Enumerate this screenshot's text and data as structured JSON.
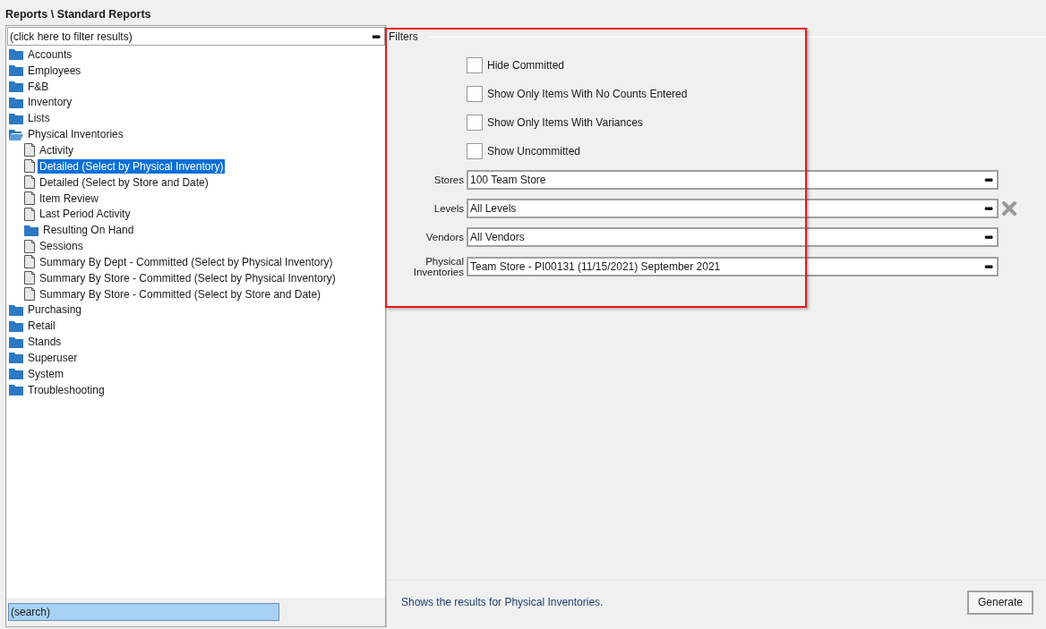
{
  "breadcrumb": "Reports \\ Standard Reports",
  "filter_field": {
    "placeholder": "(click here to filter results)",
    "button": "•••"
  },
  "tree": [
    {
      "label": "Accounts",
      "kind": "folder",
      "expanded": false,
      "selected": false
    },
    {
      "label": "Employees",
      "kind": "folder",
      "expanded": false,
      "selected": false
    },
    {
      "label": "F&B",
      "kind": "folder",
      "expanded": false,
      "selected": false
    },
    {
      "label": "Inventory",
      "kind": "folder",
      "expanded": false,
      "selected": false
    },
    {
      "label": "Lists",
      "kind": "folder",
      "expanded": false,
      "selected": false
    },
    {
      "label": "Physical Inventories",
      "kind": "folder",
      "expanded": true,
      "selected": false,
      "children": [
        {
          "label": "Activity",
          "kind": "report",
          "selected": false
        },
        {
          "label": "Detailed (Select by Physical Inventory)",
          "kind": "report",
          "selected": true
        },
        {
          "label": "Detailed (Select by Store and Date)",
          "kind": "report",
          "selected": false
        },
        {
          "label": "Item Review",
          "kind": "report",
          "selected": false
        },
        {
          "label": "Last Period Activity",
          "kind": "report",
          "selected": false
        },
        {
          "label": "Resulting On Hand",
          "kind": "folder",
          "expanded": false,
          "selected": false
        },
        {
          "label": "Sessions",
          "kind": "report",
          "selected": false
        },
        {
          "label": "Summary By Dept - Committed (Select by Physical Inventory)",
          "kind": "report",
          "selected": false
        },
        {
          "label": "Summary By Store - Committed (Select by Physical Inventory)",
          "kind": "report",
          "selected": false
        },
        {
          "label": "Summary By Store - Committed (Select by Store and Date)",
          "kind": "report",
          "selected": false
        }
      ]
    },
    {
      "label": "Purchasing",
      "kind": "folder",
      "expanded": false,
      "selected": false
    },
    {
      "label": "Retail",
      "kind": "folder",
      "expanded": false,
      "selected": false
    },
    {
      "label": "Stands",
      "kind": "folder",
      "expanded": false,
      "selected": false
    },
    {
      "label": "Superuser",
      "kind": "folder",
      "expanded": false,
      "selected": false
    },
    {
      "label": "System",
      "kind": "folder",
      "expanded": false,
      "selected": false
    },
    {
      "label": "Troubleshooting",
      "kind": "folder",
      "expanded": false,
      "selected": false
    }
  ],
  "search_field": {
    "placeholder": "(search)"
  },
  "filters": {
    "title": "Filters",
    "checkboxes": [
      {
        "label": "Hide Committed",
        "checked": false
      },
      {
        "label": "Show Only Items With No Counts Entered",
        "checked": false
      },
      {
        "label": "Show Only Items With Variances",
        "checked": false
      },
      {
        "label": "Show Uncommitted",
        "checked": false
      }
    ],
    "fields": [
      {
        "label": "Stores",
        "value": "100 Team Store",
        "button": "•••",
        "clearable": false
      },
      {
        "label": "Levels",
        "value": "All Levels",
        "button": "•••",
        "clearable": true
      },
      {
        "label": "Vendors",
        "value": "All Vendors",
        "button": "•••",
        "clearable": false
      },
      {
        "label": "Physical Inventories",
        "value": "Team Store - PI00131 (11/15/2021) September 2021",
        "button": "•••",
        "clearable": false
      }
    ]
  },
  "description": "Shows the results for Physical Inventories.",
  "generate_button": "Generate"
}
